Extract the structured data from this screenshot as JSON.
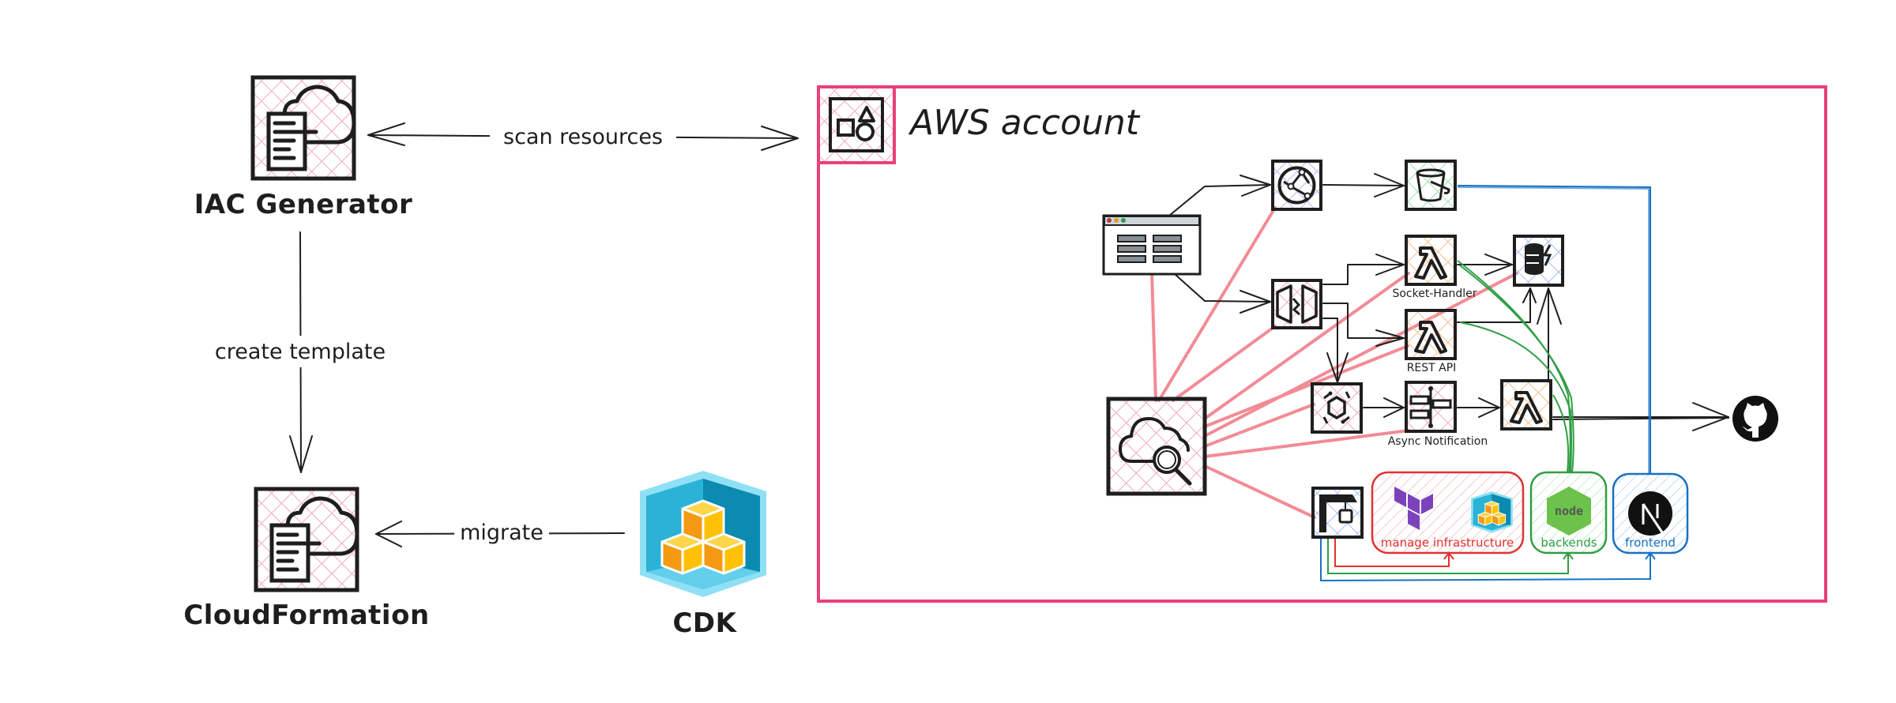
{
  "diagram": {
    "title": "AWS account",
    "nodes": {
      "iac_generator": {
        "label": "IAC Generator",
        "icon": "iac-generator-icon"
      },
      "cloudformation": {
        "label": "CloudFormation",
        "icon": "cloudformation-icon"
      },
      "cdk": {
        "label": "CDK",
        "icon": "cdk-icon"
      },
      "aws_account": {
        "label": "AWS account",
        "icon": "resource-group-icon"
      },
      "browser": {
        "icon": "browser-window-icon"
      },
      "cloudfront": {
        "icon": "cloudfront-icon"
      },
      "s3": {
        "icon": "s3-bucket-icon"
      },
      "api_gateway": {
        "icon": "api-gateway-icon"
      },
      "socket_handler": {
        "label": "Socket-Handler",
        "icon": "lambda-icon"
      },
      "rest_api": {
        "label": "REST API",
        "icon": "lambda-icon"
      },
      "dynamodb": {
        "icon": "dynamodb-icon"
      },
      "eventbridge": {
        "icon": "eventbridge-icon"
      },
      "step_functions": {
        "label": "Async Notification",
        "icon": "step-functions-icon"
      },
      "async_lambda": {
        "icon": "lambda-icon"
      },
      "resource_explorer": {
        "icon": "cloud-search-icon"
      },
      "codebuild": {
        "icon": "codebuild-icon"
      },
      "github": {
        "icon": "github-icon"
      }
    },
    "groups": {
      "manage_infrastructure": {
        "label": "manage infrastructure",
        "color": "#e03131",
        "icons": [
          "terraform-icon",
          "cdk-icon"
        ]
      },
      "backends": {
        "label": "backends",
        "color": "#2f9e44",
        "icons": [
          "nodejs-icon"
        ]
      },
      "frontend": {
        "label": "frontend",
        "color": "#1971c2",
        "icons": [
          "nextjs-icon"
        ]
      }
    },
    "edges": {
      "scan_resources": "scan resources",
      "create_template": "create template",
      "migrate": "migrate"
    },
    "node_js_text": "node",
    "colors": {
      "account_border": "#e8407a",
      "pink_hatch": "#f4a8c0",
      "scan_links": "#f28b95",
      "blue": "#1971c2",
      "green": "#2f9e44",
      "red": "#e03131"
    }
  }
}
